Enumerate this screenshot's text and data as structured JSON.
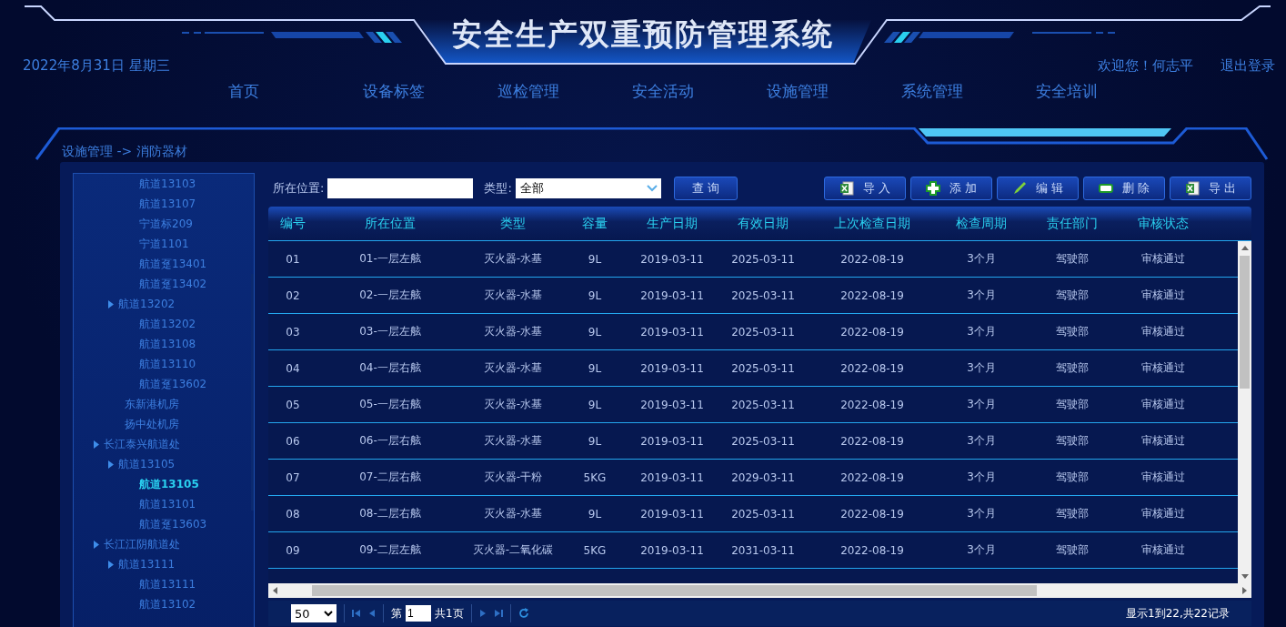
{
  "header": {
    "title": "安全生产双重预防管理系统",
    "date": "2022年8月31日 星期三",
    "welcome": "欢迎您！何志平",
    "logout": "退出登录"
  },
  "nav": [
    {
      "label": "首页",
      "selected": false
    },
    {
      "label": "设备标签",
      "selected": false
    },
    {
      "label": "巡检管理",
      "selected": false
    },
    {
      "label": "安全活动",
      "selected": false
    },
    {
      "label": "设施管理",
      "selected": false
    },
    {
      "label": "系统管理",
      "selected": false
    },
    {
      "label": "安全培训",
      "selected": false
    }
  ],
  "breadcrumb": "设施管理 -> 消防器材",
  "tree": [
    {
      "children": [
        {
          "children": [
            {
              "label": "航道13103",
              "selected": false
            },
            {
              "label": "航道13107",
              "selected": false
            },
            {
              "label": "宁道标209",
              "selected": false
            },
            {
              "label": "宁道1101",
              "selected": false
            },
            {
              "label": "航道趸13401",
              "selected": false
            },
            {
              "label": "航道趸13402",
              "selected": false
            }
          ]
        },
        {
          "label": "航道13202",
          "selected": false,
          "children": [
            {
              "label": "航道13202",
              "selected": false
            },
            {
              "label": "航道13108",
              "selected": false
            },
            {
              "label": "航道13110",
              "selected": false
            },
            {
              "label": "航道趸13602",
              "selected": false
            }
          ]
        },
        {
          "label": "东新港机房",
          "selected": false
        },
        {
          "label": "扬中处机房",
          "selected": false
        }
      ]
    },
    {
      "label": "长江泰兴航道处",
      "selected": false,
      "children": [
        {
          "label": "航道13105",
          "selected": false,
          "children": [
            {
              "label": "航道13105",
              "selected": true
            },
            {
              "label": "航道13101",
              "selected": false
            },
            {
              "label": "航道趸13603",
              "selected": false
            }
          ]
        }
      ]
    },
    {
      "label": "长江江阴航道处",
      "selected": false,
      "children": [
        {
          "label": "航道13111",
          "selected": false,
          "children": [
            {
              "label": "航道13111",
              "selected": false
            },
            {
              "label": "航道13102",
              "selected": false
            }
          ]
        }
      ]
    }
  ],
  "filters": {
    "location_label": "所在位置:",
    "type_label": "类型:",
    "type_value": "全部",
    "query_button": "查 询"
  },
  "toolbar": [
    {
      "kind": "import",
      "label": "导 入"
    },
    {
      "kind": "add",
      "label": "添 加"
    },
    {
      "kind": "edit",
      "label": "编 辑"
    },
    {
      "kind": "delete",
      "label": "删 除"
    },
    {
      "kind": "export",
      "label": "导 出"
    }
  ],
  "table": {
    "columns": [
      "编号",
      "所在位置",
      "类型",
      "容量",
      "生产日期",
      "有效日期",
      "上次检查日期",
      "检查周期",
      "责任部门",
      "审核状态"
    ],
    "rows": [
      [
        "01",
        "01-一层左舷",
        "灭火器-水基",
        "9L",
        "2019-03-11",
        "2025-03-11",
        "2022-08-19",
        "3个月",
        "驾驶部",
        "审核通过"
      ],
      [
        "02",
        "02-一层左舷",
        "灭火器-水基",
        "9L",
        "2019-03-11",
        "2025-03-11",
        "2022-08-19",
        "3个月",
        "驾驶部",
        "审核通过"
      ],
      [
        "03",
        "03-一层左舷",
        "灭火器-水基",
        "9L",
        "2019-03-11",
        "2025-03-11",
        "2022-08-19",
        "3个月",
        "驾驶部",
        "审核通过"
      ],
      [
        "04",
        "04-一层右舷",
        "灭火器-水基",
        "9L",
        "2019-03-11",
        "2025-03-11",
        "2022-08-19",
        "3个月",
        "驾驶部",
        "审核通过"
      ],
      [
        "05",
        "05-一层右舷",
        "灭火器-水基",
        "9L",
        "2019-03-11",
        "2025-03-11",
        "2022-08-19",
        "3个月",
        "驾驶部",
        "审核通过"
      ],
      [
        "06",
        "06-一层右舷",
        "灭火器-水基",
        "9L",
        "2019-03-11",
        "2025-03-11",
        "2022-08-19",
        "3个月",
        "驾驶部",
        "审核通过"
      ],
      [
        "07",
        "07-二层右舷",
        "灭火器-干粉",
        "5KG",
        "2019-03-11",
        "2029-03-11",
        "2022-08-19",
        "3个月",
        "驾驶部",
        "审核通过"
      ],
      [
        "08",
        "08-二层右舷",
        "灭火器-水基",
        "9L",
        "2019-03-11",
        "2025-03-11",
        "2022-08-19",
        "3个月",
        "驾驶部",
        "审核通过"
      ],
      [
        "09",
        "09-二层左舷",
        "灭火器-二氧化碳",
        "5KG",
        "2019-03-11",
        "2031-03-11",
        "2022-08-19",
        "3个月",
        "驾驶部",
        "审核通过"
      ]
    ]
  },
  "pagination": {
    "page_size": "50",
    "page_prefix": "第",
    "page": "1",
    "page_total": "共1页",
    "summary": "显示1到22,共22记录"
  }
}
